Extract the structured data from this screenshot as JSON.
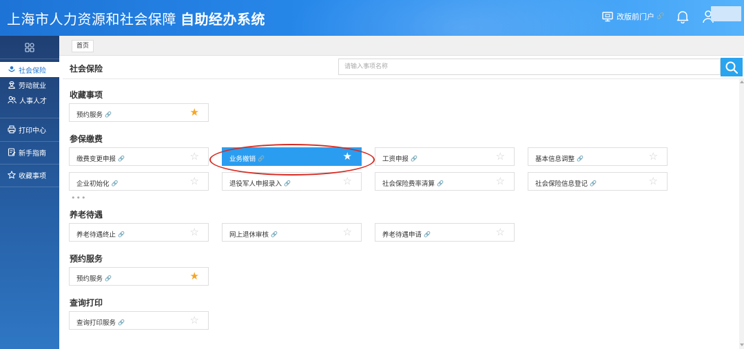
{
  "header": {
    "title_main": "上海市人力资源和社会保障",
    "title_sub": "自助经办系统",
    "portal_label": "改版前门户",
    "link_icon": "🔗",
    "icons": [
      "monitor-icon",
      "bell-icon",
      "user-icon"
    ]
  },
  "sidebar": {
    "top_icon": "grid-icon",
    "items": [
      {
        "label": "社会保险",
        "icon": "shield-person-icon",
        "active": true
      },
      {
        "label": "劳动就业",
        "icon": "worker-icon"
      },
      {
        "label": "人事人才",
        "icon": "people-icon"
      },
      {
        "label": "打印中心",
        "icon": "printer-icon"
      },
      {
        "label": "新手指南",
        "icon": "guide-icon"
      },
      {
        "label": "收藏事项",
        "icon": "star-outline-icon"
      }
    ]
  },
  "breadcrumb": {
    "home": "首页"
  },
  "page": {
    "title": "社会保险",
    "search_placeholder": "请输入事项名称"
  },
  "sections": [
    {
      "title": "收藏事项",
      "items": [
        {
          "label": "预约服务",
          "favorite": true
        }
      ]
    },
    {
      "title": "参保缴费",
      "items": [
        {
          "label": "缴费变更申报",
          "favorite": false
        },
        {
          "label": "业务撤销",
          "favorite": true,
          "selected": true
        },
        {
          "label": "工资申报",
          "favorite": false
        },
        {
          "label": "基本信息调整",
          "favorite": false
        },
        {
          "label": "企业初始化",
          "favorite": false
        },
        {
          "label": "退役军人申报录入",
          "favorite": false
        },
        {
          "label": "社会保险费率清算",
          "favorite": false
        },
        {
          "label": "社会保险信息登记",
          "favorite": false
        }
      ]
    },
    {
      "title": "养老待遇",
      "items": [
        {
          "label": "养老待遇终止",
          "favorite": false
        },
        {
          "label": "网上退休审核",
          "favorite": false
        },
        {
          "label": "养老待遇申请",
          "favorite": false
        }
      ]
    },
    {
      "title": "预约服务",
      "items": [
        {
          "label": "预约服务",
          "favorite": true
        }
      ]
    },
    {
      "title": "查询打印",
      "items": [
        {
          "label": "查询打印服务",
          "favorite": false
        }
      ]
    }
  ],
  "more_indicator": "•••",
  "colors": {
    "header_gradient_start": "#1d74d6",
    "header_gradient_end": "#55b2fb",
    "sidebar_dark": "#1f3f72",
    "accent": "#2b9df0",
    "favorite_star": "#f5a623",
    "annotation_red": "#d62b22"
  }
}
